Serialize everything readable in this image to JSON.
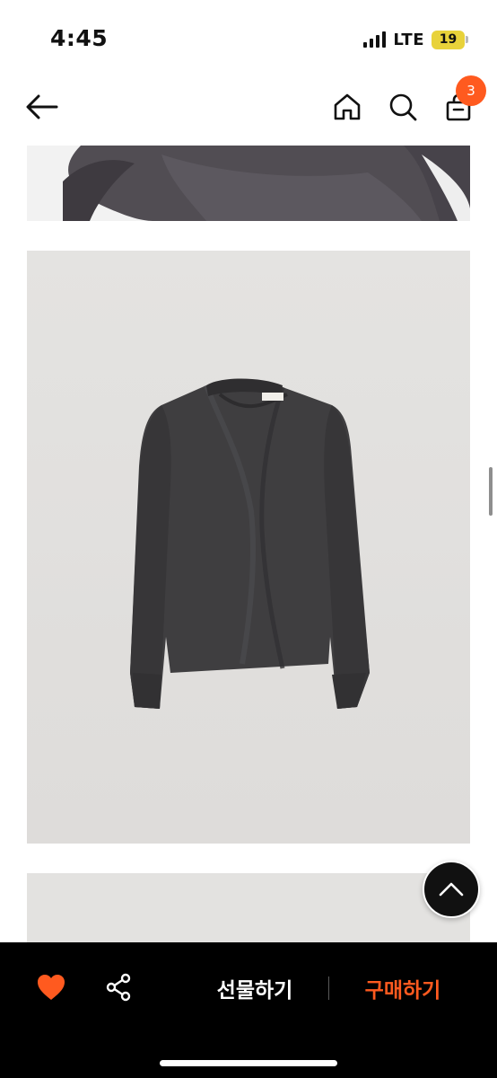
{
  "status_bar": {
    "time": "4:45",
    "network": "LTE",
    "battery": "19"
  },
  "header": {
    "back_icon": "arrow-left-icon",
    "home_icon": "home-icon",
    "search_icon": "search-icon",
    "cart_icon": "shopping-bag-icon",
    "cart_count": "3",
    "badge_color": "#ff5a1f"
  },
  "gallery": {
    "images": [
      {
        "name": "product-image-detail",
        "subject": "dark gray satin blouse close-up"
      },
      {
        "name": "product-image-main",
        "subject": "dark gray draped-neck long-sleeve blouse"
      },
      {
        "name": "product-image-next",
        "subject": "light gray backdrop"
      }
    ],
    "scroll_top_icon": "chevron-up-icon"
  },
  "bottom_bar": {
    "like_icon": "heart-icon",
    "share_icon": "share-icon",
    "gift_label": "선물하기",
    "buy_label": "구매하기",
    "accent_color": "#ff5a1f"
  }
}
